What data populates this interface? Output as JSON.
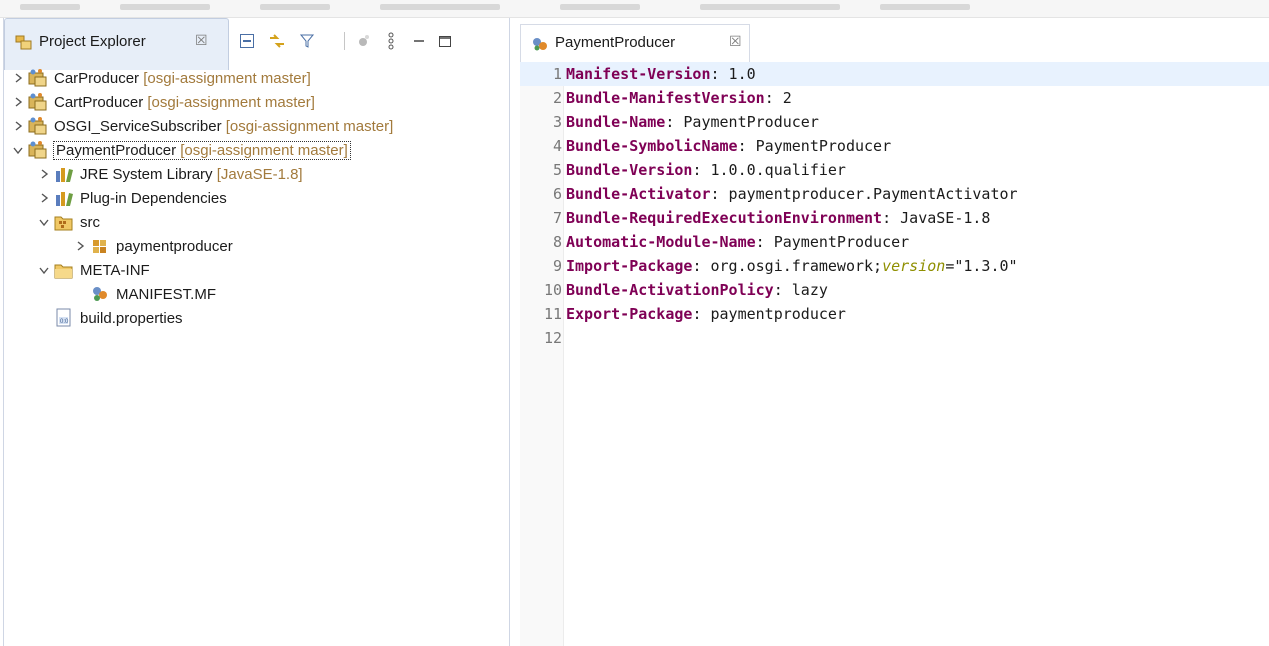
{
  "explorer": {
    "tab_title": "Project Explorer",
    "close_glyph": "☒",
    "toolbar": [
      "collapse-all-icon",
      "link-with-editor-icon",
      "filter-icon",
      "focus-icon",
      "view-menu-icon",
      "minimize-icon",
      "maximize-icon"
    ],
    "tree": [
      {
        "label": "CarProducer",
        "decoration": "[osgi-assignment master]",
        "level": 0,
        "state": "collapsed",
        "icon": "plugin-project-icon"
      },
      {
        "label": "CartProducer",
        "decoration": "[osgi-assignment master]",
        "level": 0,
        "state": "collapsed",
        "icon": "plugin-project-icon"
      },
      {
        "label": "OSGI_ServiceSubscriber",
        "decoration": "[osgi-assignment master]",
        "level": 0,
        "state": "collapsed",
        "icon": "plugin-project-icon"
      },
      {
        "label": "PaymentProducer",
        "decoration": "[osgi-assignment master]",
        "level": 0,
        "state": "expanded",
        "icon": "plugin-project-icon"
      },
      {
        "label": "JRE System Library",
        "decoration": "[JavaSE-1.8]",
        "level": 1,
        "state": "collapsed",
        "icon": "library-icon"
      },
      {
        "label": "Plug-in Dependencies",
        "decoration": "",
        "level": 1,
        "state": "collapsed",
        "icon": "library-icon"
      },
      {
        "label": "src",
        "decoration": "",
        "level": 1,
        "state": "expanded",
        "icon": "source-folder-icon"
      },
      {
        "label": "paymentproducer",
        "decoration": "",
        "level": 2,
        "state": "collapsed",
        "icon": "package-icon"
      },
      {
        "label": "META-INF",
        "decoration": "",
        "level": 1,
        "state": "expanded",
        "icon": "folder-icon"
      },
      {
        "label": "MANIFEST.MF",
        "decoration": "",
        "level": 2,
        "state": "leaf",
        "icon": "manifest-file-icon"
      },
      {
        "label": "build.properties",
        "decoration": "",
        "level": 1,
        "state": "leaf",
        "icon": "properties-file-icon"
      }
    ]
  },
  "editor": {
    "tab_title": "PaymentProducer",
    "close_glyph": "☒",
    "lines": [
      {
        "num": "1",
        "key": "Manifest-Version",
        "value": " 1.0"
      },
      {
        "num": "2",
        "key": "Bundle-ManifestVersion",
        "value": " 2"
      },
      {
        "num": "3",
        "key": "Bundle-Name",
        "value": " PaymentProducer"
      },
      {
        "num": "4",
        "key": "Bundle-SymbolicName",
        "value": " PaymentProducer"
      },
      {
        "num": "5",
        "key": "Bundle-Version",
        "value": " 1.0.0.qualifier"
      },
      {
        "num": "6",
        "key": "Bundle-Activator",
        "value": " paymentproducer.PaymentActivator"
      },
      {
        "num": "7",
        "key": "Bundle-RequiredExecutionEnvironment",
        "value": " JavaSE-1.8"
      },
      {
        "num": "8",
        "key": "Automatic-Module-Name",
        "value": " PaymentProducer"
      },
      {
        "num": "9",
        "key": "Import-Package",
        "value": " org.osgi.framework;",
        "attr": "version",
        "attr_value": "=\"1.3.0\""
      },
      {
        "num": "10",
        "key": "Bundle-ActivationPolicy",
        "value": " lazy"
      },
      {
        "num": "11",
        "key": "Export-Package",
        "value": " paymentproducer"
      },
      {
        "num": "12",
        "key": "",
        "value": ""
      }
    ]
  },
  "colors": {
    "manifest_key": "#7f0055",
    "attribute": "#8f8f00",
    "decoration": "#a27a3c",
    "current_line": "#e8f2fe"
  }
}
